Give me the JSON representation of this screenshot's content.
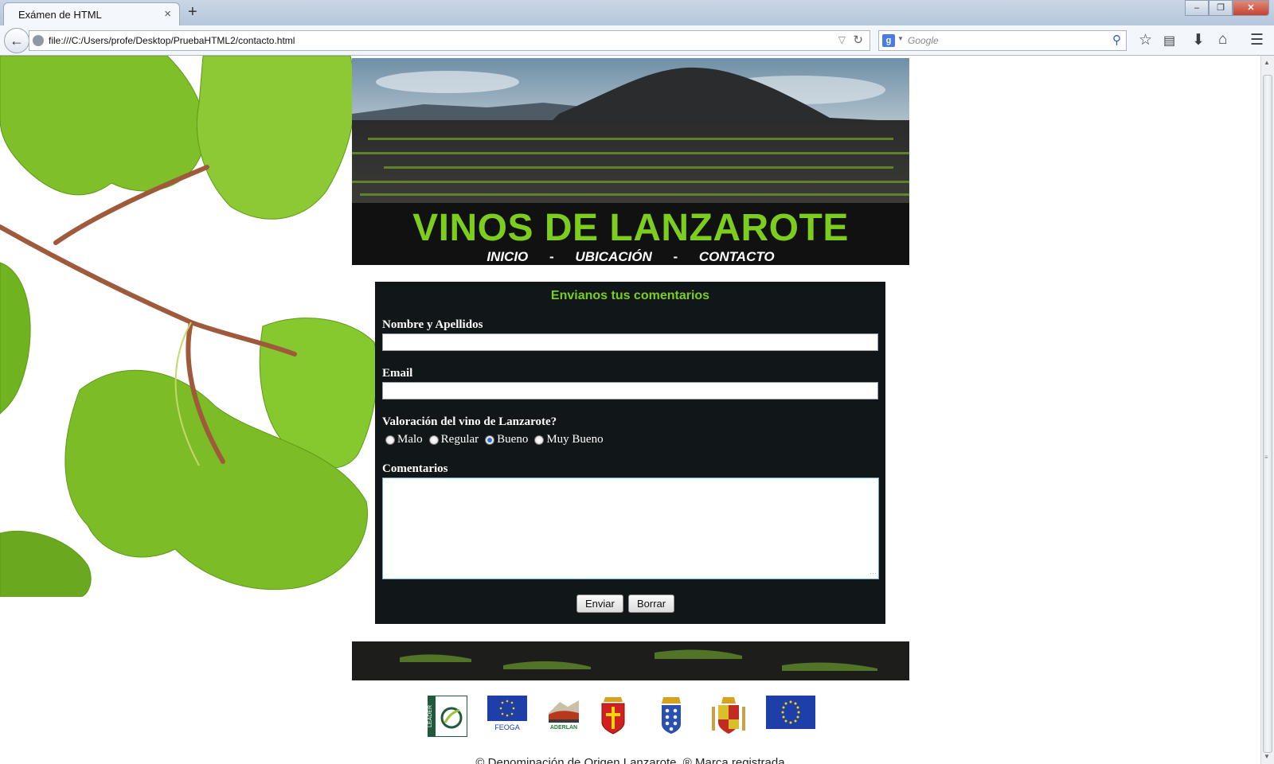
{
  "browser": {
    "tab_title": "Exámen de HTML",
    "tab_close": "×",
    "new_tab": "+",
    "url": "file:///C:/Users/profe/Desktop/PruebaHTML2/contacto.html",
    "search_placeholder": "Google",
    "window_buttons": {
      "minimize": "‒",
      "restore": "❐",
      "close": "✕"
    }
  },
  "site": {
    "title": "VINOS DE LANZAROTE",
    "nav": [
      "INICIO",
      "UBICACIÓN",
      "CONTACTO"
    ],
    "nav_separator": "-"
  },
  "form": {
    "heading": "Envianos tus comentarios",
    "name_label": "Nombre y Apellidos",
    "name_value": "",
    "email_label": "Email",
    "email_value": "",
    "rating_label": "Valoración del vino de Lanzarote?",
    "rating_options": [
      "Malo",
      "Regular",
      "Bueno",
      "Muy Bueno"
    ],
    "rating_selected": "Bueno",
    "comments_label": "Comentarios",
    "comments_value": "",
    "submit_label": "Enviar",
    "reset_label": "Borrar"
  },
  "logos": [
    "leader-logo",
    "feoga-logo",
    "aderlan-logo",
    "lanzarote-shield",
    "canarias-shield",
    "spain-coat-of-arms",
    "eu-flag"
  ],
  "logo_texts": {
    "feoga": "FEOGA",
    "aderlan": "ADERLAN",
    "leader": "LEADER"
  },
  "footer": {
    "copyright": "© Denominación de Origen Lanzarote. ® Marca registrada"
  },
  "colors": {
    "accent_green": "#7ccd1d",
    "panel_dark": "#111619"
  }
}
